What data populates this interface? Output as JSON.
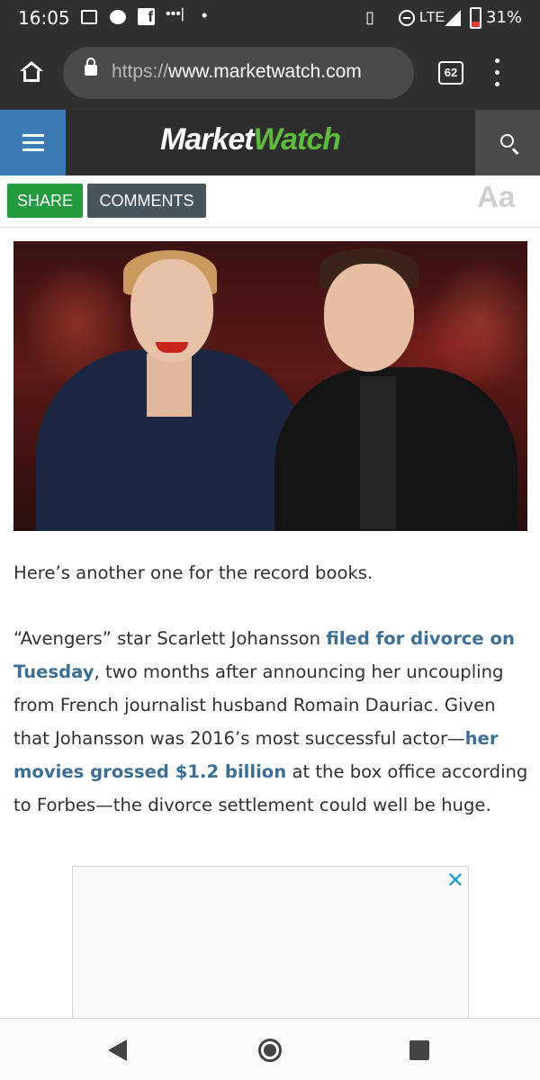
{
  "status_bar": {
    "time": "16:05",
    "network": "LTE",
    "battery_percent": "31%",
    "battery_level": 0.31
  },
  "browser": {
    "url_scheme": "https://",
    "url_host": "www.marketwatch.com",
    "tab_count": "62"
  },
  "site": {
    "logo_market": "Market",
    "logo_watch": "Watch",
    "logo_color": "#5fbb3c",
    "menu_color": "#3d7bb6"
  },
  "toolbar": {
    "share_label": "SHARE",
    "comments_label": "COMMENTS",
    "font_label": "Aa"
  },
  "article": {
    "p1": "Here’s another one for the record books.",
    "p2_a": "“Avengers” star Scarlett Johansson ",
    "p2_link1": "filed for divorce on Tuesday",
    "p2_b": ", two months after announcing her uncoupling from French journalist husband Romain Dauriac. Given that Johansson was 2016’s most successful actor—",
    "p2_link2": "her movies grossed $1.2 billion",
    "p2_c": " at the box office according to Forbes—the divorce settlement could well be huge.",
    "link_color": "#3d6f94"
  },
  "ad": {
    "close_label": "✕"
  }
}
